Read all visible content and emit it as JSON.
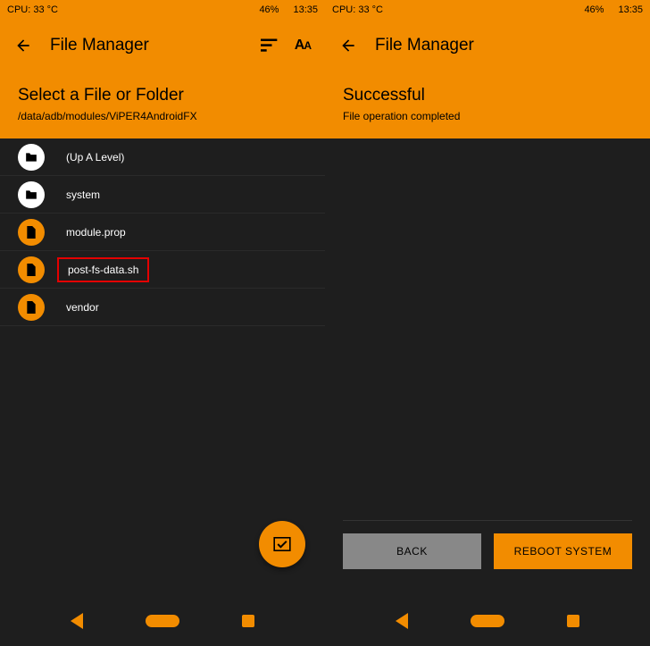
{
  "statusbar": {
    "cpu": "CPU: 33 °C",
    "battery": "46%",
    "clock": "13:35"
  },
  "left": {
    "title": "File Manager",
    "subtitle": "Select a File or Folder",
    "path": "/data/adb/modules/ViPER4AndroidFX",
    "items": [
      {
        "label": "(Up A Level)",
        "type": "up"
      },
      {
        "label": "system",
        "type": "folder"
      },
      {
        "label": "module.prop",
        "type": "file"
      },
      {
        "label": "post-fs-data.sh",
        "type": "file",
        "highlight": true
      },
      {
        "label": "vendor",
        "type": "file"
      }
    ]
  },
  "right": {
    "title": "File Manager",
    "subtitle": "Successful",
    "message": "File operation completed",
    "back": "BACK",
    "reboot": "REBOOT SYSTEM"
  }
}
